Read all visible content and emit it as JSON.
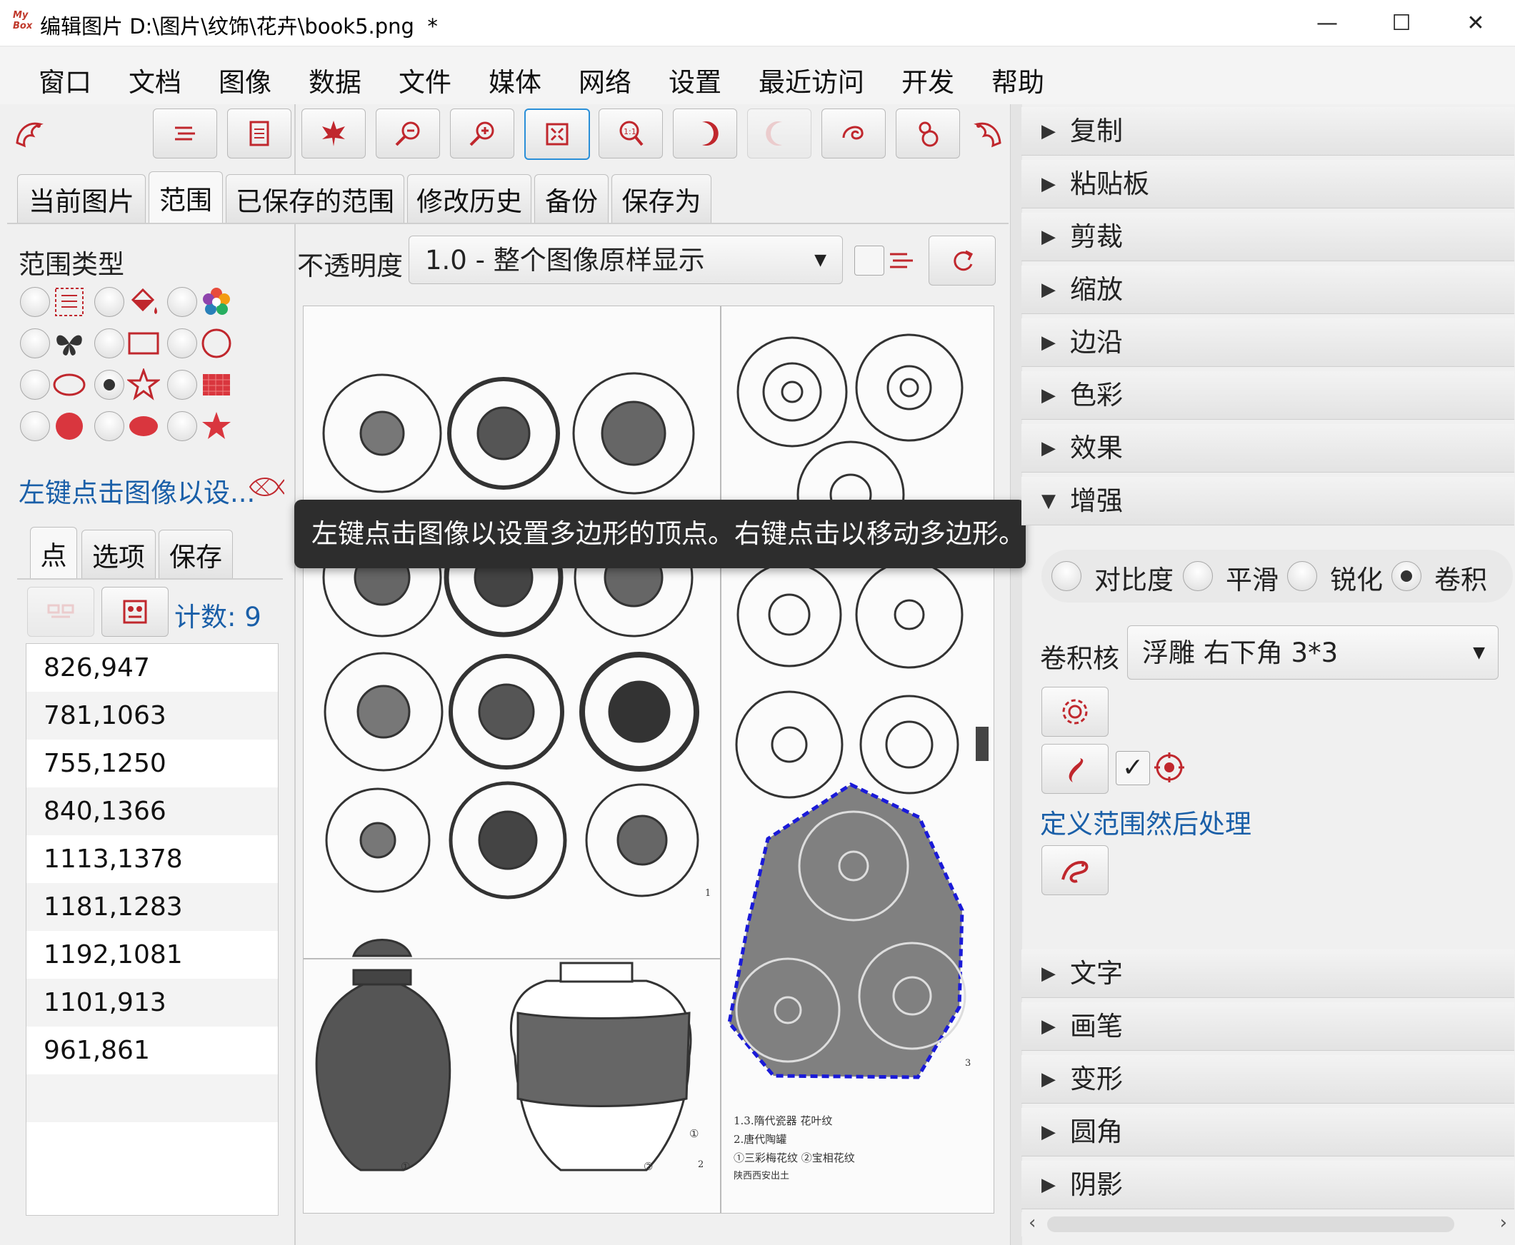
{
  "window": {
    "logo_text": "My Box",
    "title": "编辑图片 D:\\图片\\纹饰\\花卉\\book5.png  *",
    "minimize": "—",
    "maximize": "☐",
    "close": "✕"
  },
  "menu": [
    "窗口",
    "文档",
    "图像",
    "数据",
    "文件",
    "媒体",
    "网络",
    "设置",
    "最近访问",
    "开发",
    "帮助"
  ],
  "main_tabs": [
    "当前图片",
    "范围",
    "已保存的范围",
    "修改历史",
    "备份",
    "保存为"
  ],
  "left": {
    "scope_type_label": "范围类型",
    "hint": "左键点击图像以设...",
    "sub_tabs": [
      "点",
      "选项",
      "保存"
    ],
    "count": "计数: 9",
    "points": [
      "826,947",
      "781,1063",
      "755,1250",
      "840,1366",
      "1113,1378",
      "1181,1283",
      "1192,1081",
      "1101,913",
      "961,861"
    ]
  },
  "center": {
    "opacity_label": "不透明度",
    "opacity_value": "1.0 - 整个图像原样显示",
    "tooltip": "左键点击图像以设置多边形的顶点。右键点击以移动多边形。",
    "caption_lines": [
      "1.3.隋代瓷器  花叶纹",
      "2.唐代陶罐",
      "①三彩梅花纹  ②宝相花纹",
      "陕西西安出土"
    ],
    "page_numbers": [
      "1",
      "2",
      "3"
    ],
    "figure_marks": [
      "①",
      "②"
    ]
  },
  "right": {
    "accordion_top": [
      "复制",
      "粘贴板",
      "剪裁",
      "缩放",
      "边沿",
      "色彩",
      "效果",
      "增强"
    ],
    "enhance_options": [
      "对比度",
      "平滑",
      "锐化",
      "卷积"
    ],
    "kernel_label": "卷积核",
    "kernel_value": "浮雕 右下角 3*3",
    "define_link": "定义范围然后处理",
    "accordion_bottom": [
      "文字",
      "画笔",
      "变形",
      "圆角",
      "阴影"
    ]
  },
  "colors": {
    "accent_red": "#c0272d",
    "link_blue": "#1a5fa8",
    "polygon_blue": "#1a1ad8"
  }
}
